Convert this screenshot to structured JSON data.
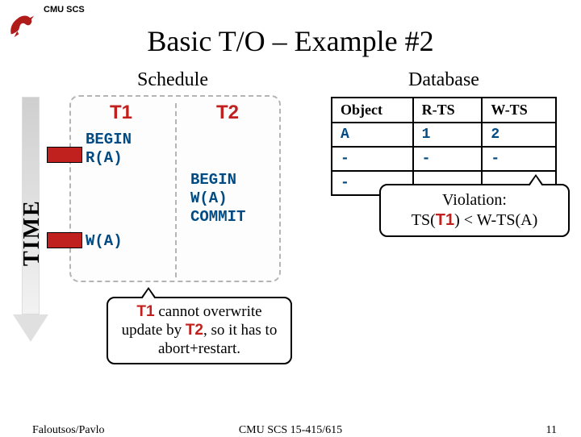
{
  "header": {
    "org": "CMU SCS"
  },
  "title": "Basic T/O – Example #2",
  "labels": {
    "schedule": "Schedule",
    "database": "Database",
    "time": "TIME"
  },
  "schedule": {
    "t1": {
      "name": "T1",
      "ops1": "BEGIN\nR(A)",
      "ops2": "W(A)"
    },
    "t2": {
      "name": "T2",
      "ops": "BEGIN\nW(A)\nCOMMIT"
    }
  },
  "db": {
    "headers": {
      "object": "Object",
      "rts": "R-TS",
      "wts": "W-TS"
    },
    "rows": [
      {
        "obj": "A",
        "rts": "1",
        "wts": "2"
      },
      {
        "obj": "-",
        "rts": "-",
        "wts": "-"
      },
      {
        "obj": "-",
        "rts": "",
        "wts": ""
      }
    ]
  },
  "callouts": {
    "abort_line1": "T1",
    "abort_line2": " cannot overwrite update by ",
    "abort_line3": "T2",
    "abort_line4": ", so it has to abort+restart.",
    "violation_label": "Violation:",
    "violation_expr_pre": "TS(",
    "violation_t": "T1",
    "violation_expr_post": ") < W-TS(A)"
  },
  "footer": {
    "left": "Faloutsos/Pavlo",
    "center": "CMU SCS 15-415/615",
    "right": "11"
  }
}
